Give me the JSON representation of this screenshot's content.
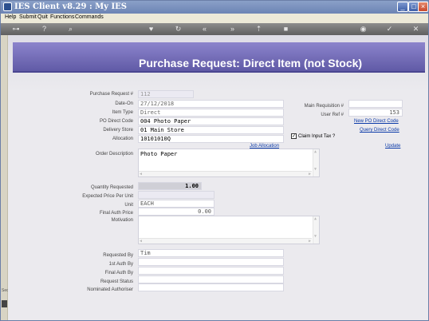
{
  "window": {
    "title": "IES Client v8.29 : My IES",
    "controls": [
      "minimize",
      "maximize",
      "close"
    ]
  },
  "menu": [
    "Help",
    "Submit",
    "Quit",
    "Functions",
    "Commands"
  ],
  "toolbar_icons": [
    "key-icon",
    "help-icon",
    "search-icon",
    "heart-icon",
    "refresh-icon",
    "rewind-icon",
    "fast-forward-icon",
    "upload-icon",
    "stop-icon",
    "save-icon",
    "check-icon",
    "close-icon"
  ],
  "leftstrip": {
    "label": "Secu"
  },
  "page": {
    "title": "Purchase Request: Direct Item (not Stock)"
  },
  "form": {
    "purchase_request_no": {
      "label": "Purchase Request #",
      "value": "112"
    },
    "date_on": {
      "label": "Date-On",
      "value": "27/12/2018"
    },
    "item_type": {
      "label": "Item Type",
      "value": "Direct"
    },
    "po_direct_code": {
      "label": "PO Direct Code",
      "value": "004 Photo Paper"
    },
    "delivery_store": {
      "label": "Delivery Store",
      "value": "01 Main Store"
    },
    "allocation": {
      "label": "Allocation",
      "value": "10101010Q"
    },
    "main_requisition_no": {
      "label": "Main Requisition #",
      "value": ""
    },
    "user_ref_no": {
      "label": "User Ref #",
      "value": "153"
    },
    "new_po_direct_code": "New PO Direct Code",
    "query_direct_code": "Query Direct Code",
    "claim_input_tax": {
      "label": "Claim Input Tax ?",
      "checked": true
    },
    "job_allocation": "Job Allocation",
    "update": "Update",
    "order_description": {
      "label": "Order Description",
      "value": "Photo Paper"
    },
    "quantity_requested": {
      "label": "Quantity Requested",
      "value": "1.00"
    },
    "expected_price_per_unit": {
      "label": "Expected Price Per Unit",
      "value": ""
    },
    "unit": {
      "label": "Unit",
      "value": "EACH"
    },
    "final_auth_price": {
      "label": "Final Auth Price",
      "value": "0.00"
    },
    "motivation": {
      "label": "Motivation",
      "value": ""
    },
    "requested_by": {
      "label": "Requested By",
      "value": "Tim"
    },
    "first_auth_by": {
      "label": "1st Auth By",
      "value": ""
    },
    "final_auth_by": {
      "label": "Final Auth By",
      "value": ""
    },
    "request_status": {
      "label": "Request Status",
      "value": ""
    },
    "nominated_authoriser": {
      "label": "Nominated Authoriser",
      "value": ""
    }
  }
}
